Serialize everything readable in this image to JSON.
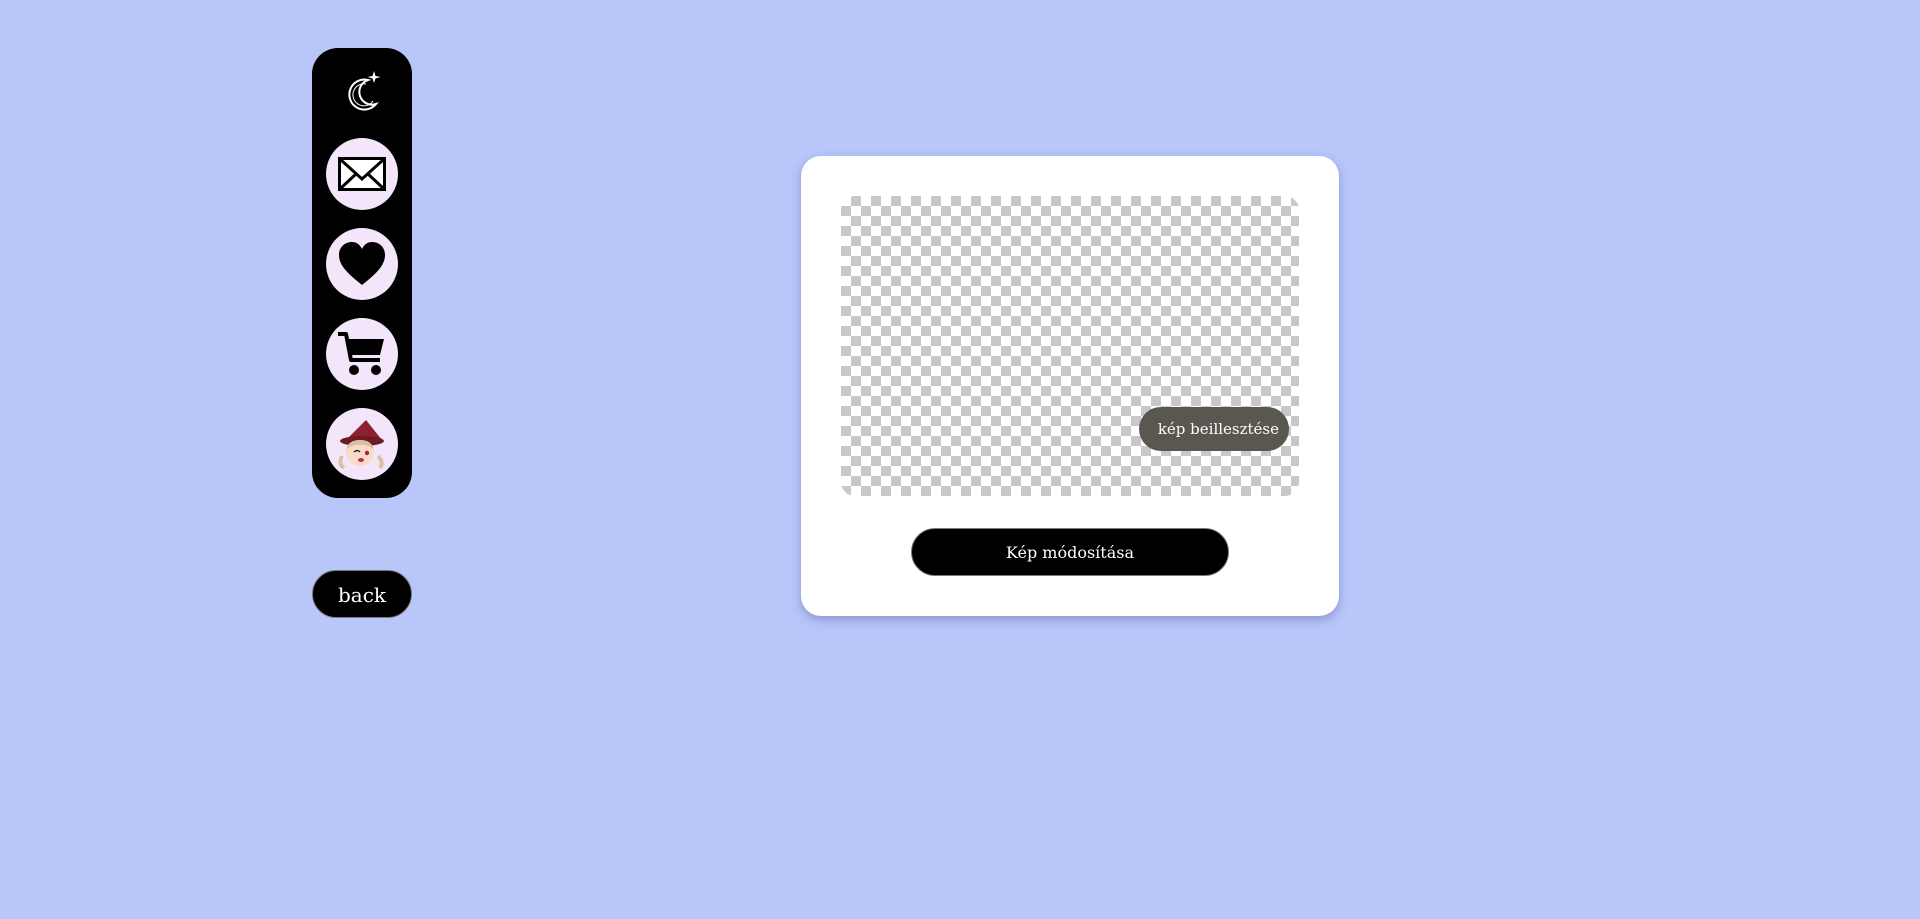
{
  "theme": {
    "background": "#b8c6fa",
    "sidebar": "#000000",
    "icon_circle": "#f3e6fb",
    "card": "#ffffff",
    "paste_button": "#5a5650"
  },
  "sidebar": {
    "logo_icon": "moon-star-logo-icon",
    "items": [
      {
        "name": "messages",
        "icon": "envelope-icon"
      },
      {
        "name": "favorites",
        "icon": "heart-icon"
      },
      {
        "name": "cart",
        "icon": "cart-icon"
      },
      {
        "name": "profile",
        "icon": "avatar-icon"
      }
    ]
  },
  "back_button": {
    "label": "back"
  },
  "editor": {
    "paste_label": "kép beillesztése",
    "modify_label": "Kép módosítása"
  }
}
